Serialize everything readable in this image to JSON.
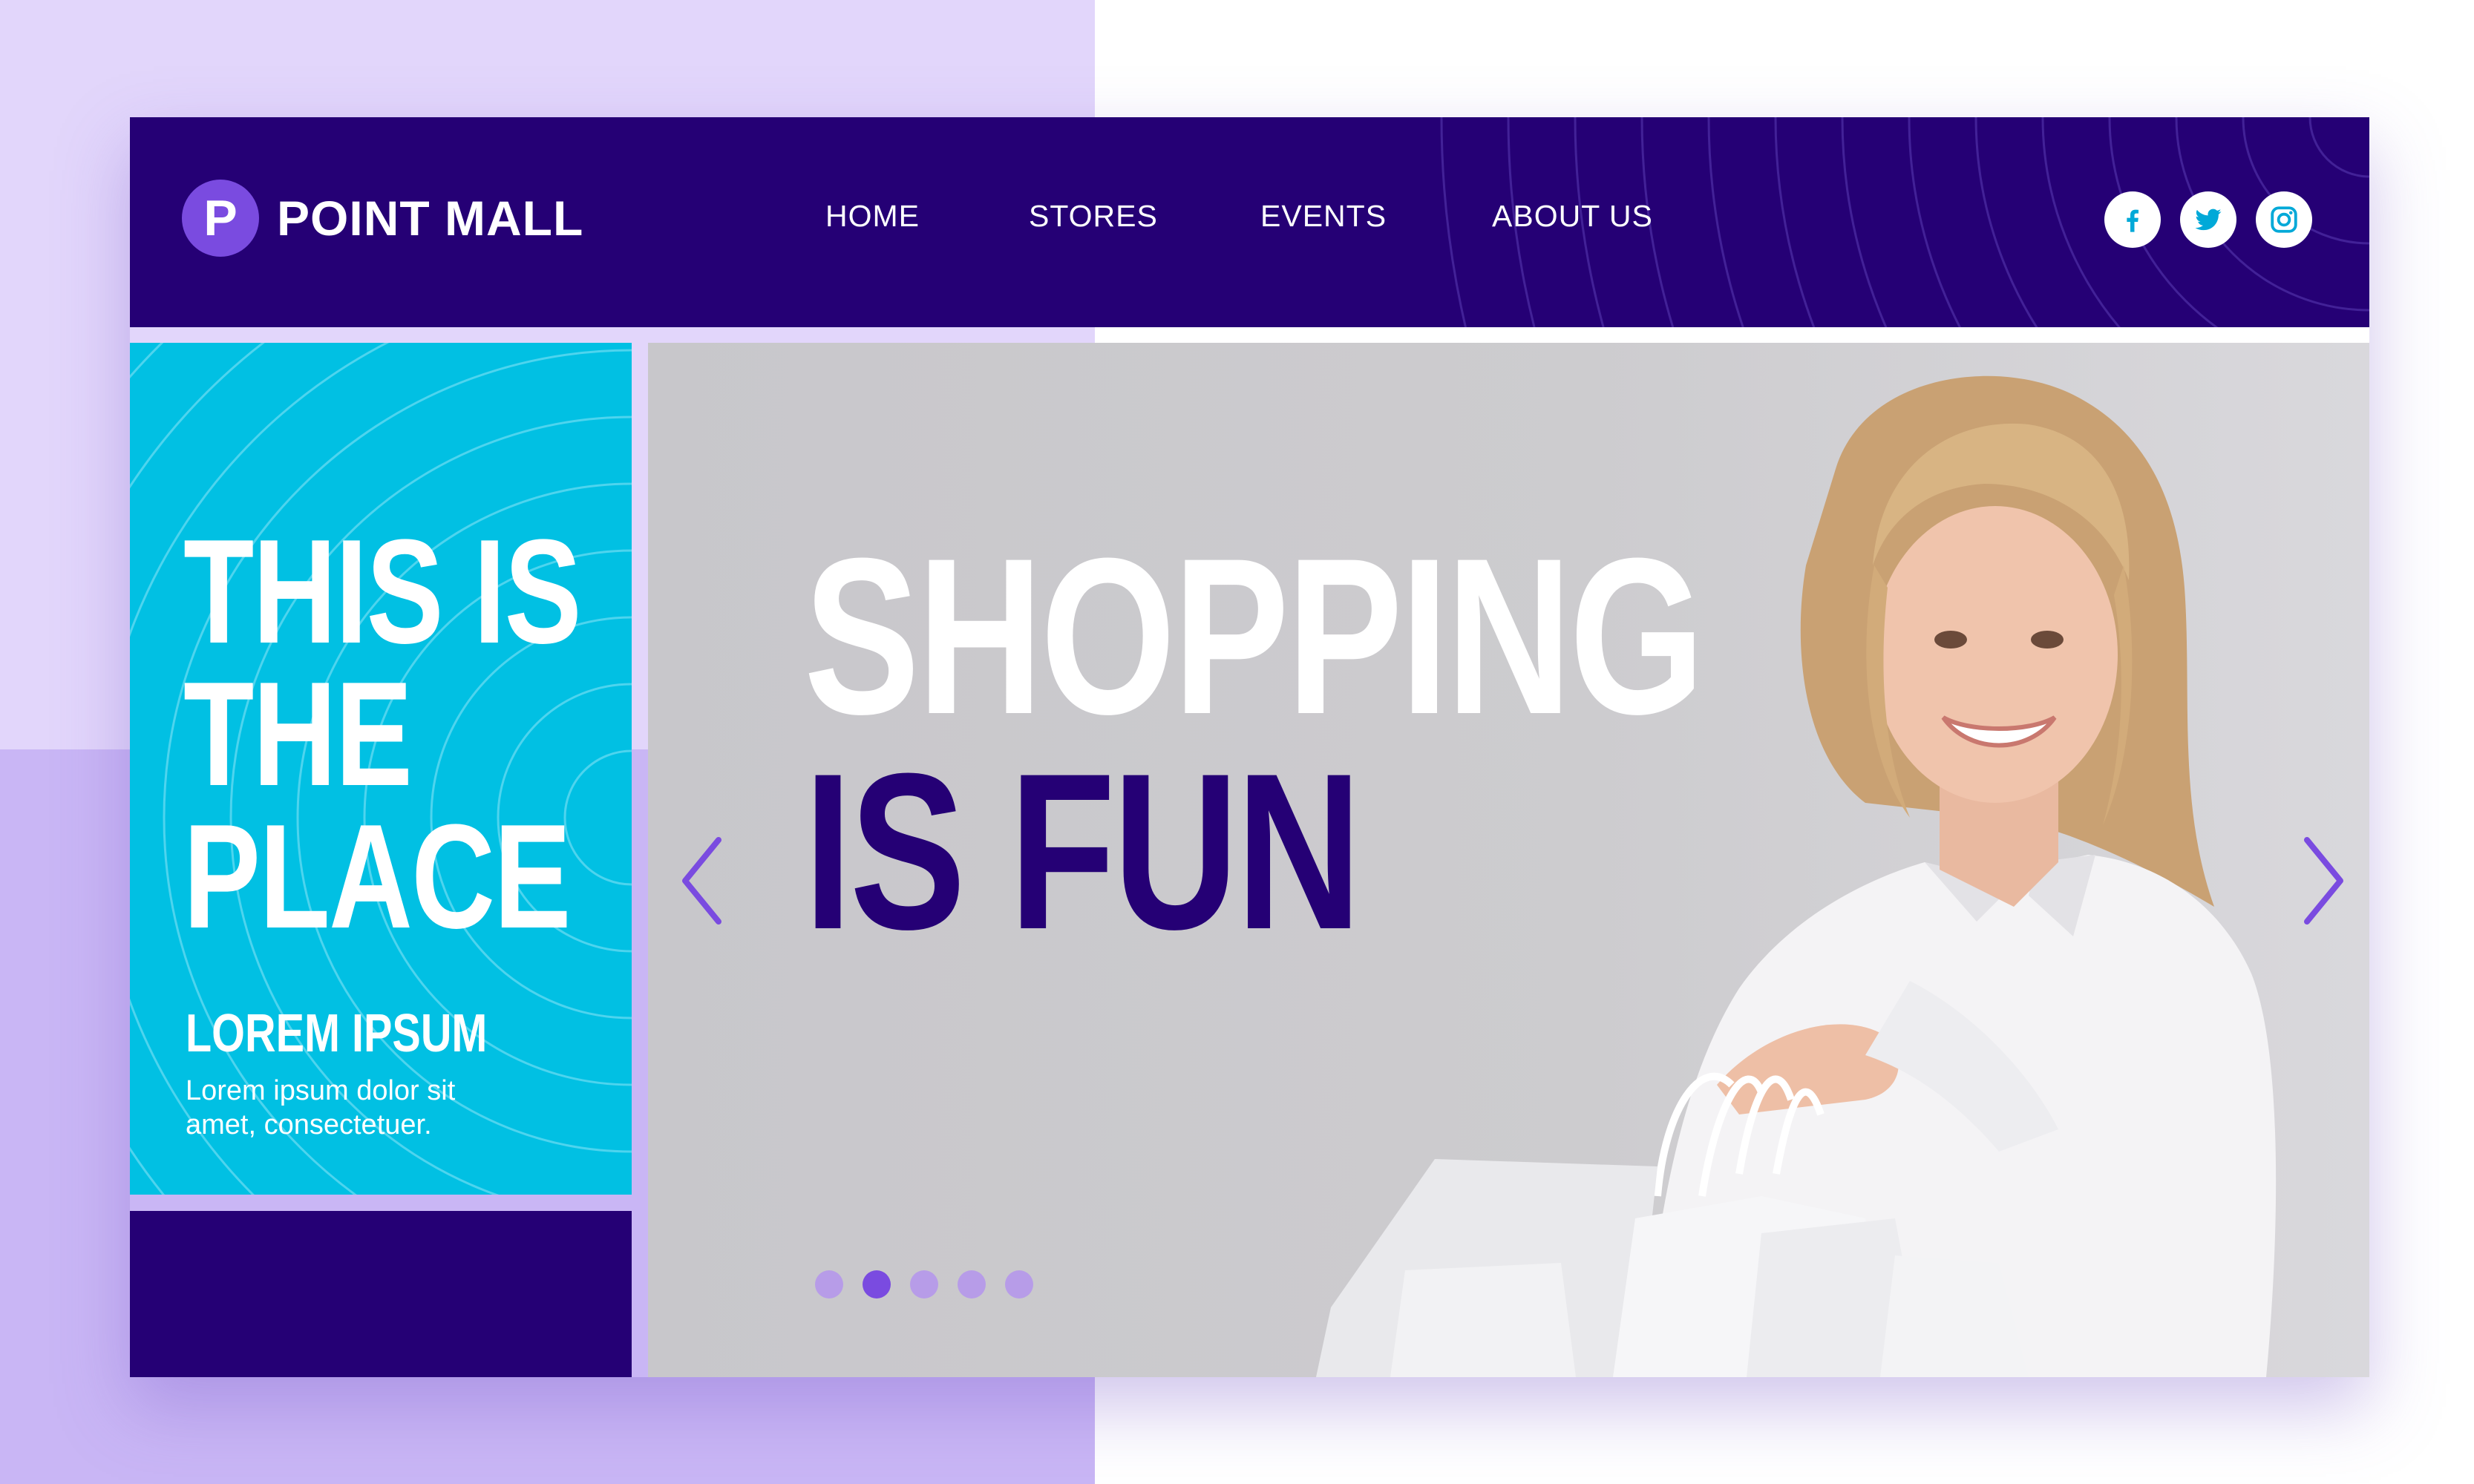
{
  "brand": {
    "logo_letter": "P",
    "name": "POINT MALL"
  },
  "nav": {
    "items": [
      {
        "label": "HOME"
      },
      {
        "label": "STORES"
      },
      {
        "label": "EVENTS"
      },
      {
        "label": "ABOUT US"
      }
    ]
  },
  "socials": [
    {
      "icon": "facebook-icon"
    },
    {
      "icon": "twitter-icon"
    },
    {
      "icon": "instagram-icon"
    }
  ],
  "left_panel": {
    "title_lines": [
      "THIS IS",
      "THE",
      "PLACE"
    ],
    "subtitle": "LOREM IPSUM",
    "body_lines": [
      "Lorem ipsum dolor sit",
      "amet, consectetuer."
    ]
  },
  "hero": {
    "headline_line1": "SHOPPING",
    "headline_line2": "IS FUN",
    "slide_count": 5,
    "active_slide": 2
  },
  "colors": {
    "navy": "#250075",
    "purple": "#7a4be0",
    "cyan": "#01c0e3",
    "lavender_light": "#e2d6fb",
    "lavender": "#c9b6f5",
    "hero_grey": "#c8c7cb"
  }
}
